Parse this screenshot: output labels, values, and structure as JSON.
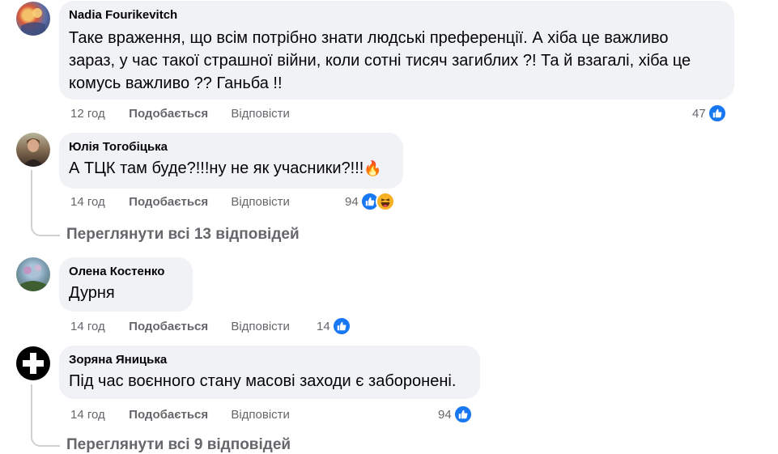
{
  "comments": [
    {
      "author": "Nadia Fourikevitch",
      "lines": [
        "Таке враження, що всім потрібно знати людські преференції. А хіба це важливо",
        "зараз, у час такої страшної війни, коли сотні тисяч загиблих ?! Та й взагалі, хіба це",
        "комусь важливо ?? Ганьба !!"
      ],
      "time": "12 год",
      "like_label": "Подобається",
      "reply_label": "Відповісти",
      "reaction_count": "47",
      "reactions": [
        "like-icon"
      ]
    },
    {
      "author": "Юлія Тогобіцька",
      "text": "А ТЦК там буде?!!!ну не як учасники?!!!",
      "emoji": "🔥",
      "time": "14 год",
      "like_label": "Подобається",
      "reply_label": "Відповісти",
      "reaction_count": "94",
      "reactions": [
        "like-icon",
        "haha-icon"
      ]
    },
    {
      "author": "Олена Костенко",
      "text": "Дурня",
      "time": "14 год",
      "like_label": "Подобається",
      "reply_label": "Відповісти",
      "reaction_count": "14",
      "reactions": [
        "like-icon"
      ]
    },
    {
      "author": "Зоряна Яницька",
      "text": "Під час воєнного стану масові заходи є заборонені.",
      "time": "14 год",
      "like_label": "Подобається",
      "reply_label": "Відповісти",
      "reaction_count": "94",
      "reactions": [
        "like-icon"
      ]
    }
  ],
  "view_replies": [
    "Переглянути всі 13 відповідей",
    "Переглянути всі 9 відповідей"
  ],
  "colors": {
    "bubble": "#f0f2f5",
    "meta": "#65676b",
    "like_blue": "#1877f2",
    "haha_yellow": "#f7b125"
  }
}
